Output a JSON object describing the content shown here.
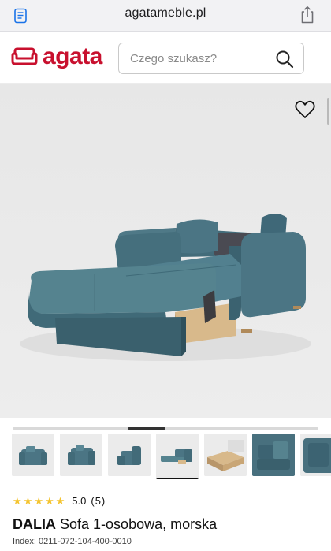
{
  "browser": {
    "url": "agatameble.pl"
  },
  "header": {
    "logo_text": "agata",
    "search_placeholder": "Czego szukasz?"
  },
  "carousel": {
    "thumbnail_count": 7,
    "active_index": 3
  },
  "product": {
    "rating_value": "5.0",
    "rating_count": "(5)",
    "stars": 5,
    "brand": "DALIA",
    "name": "Sofa 1-osobowa, morska",
    "index_label": "Index: 0211-072-104-400-0010"
  },
  "colors": {
    "brand_red": "#c8102e",
    "upholstery": "#48707e",
    "star": "#f4c430"
  },
  "icons": {
    "reader": "reader-icon",
    "share": "share-icon",
    "search": "search-icon",
    "favorite": "heart-icon",
    "logo": "sofa-logo-icon"
  }
}
